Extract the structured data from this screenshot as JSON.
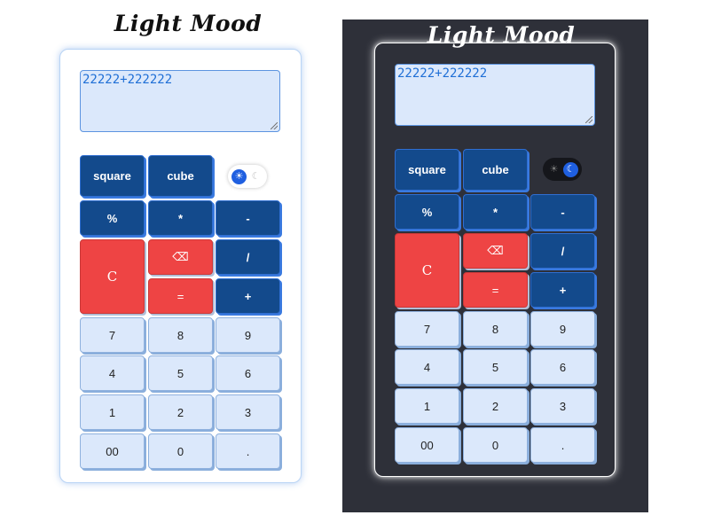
{
  "light": {
    "title": "Light Mood",
    "display_value": "22222+222222",
    "theme_mode": "light"
  },
  "dark": {
    "title": "Light Mood",
    "display_value": "22222+222222",
    "theme_mode": "dark"
  },
  "keys": {
    "square": "square",
    "cube": "cube",
    "percent": "%",
    "multiply": "*",
    "subtract": "-",
    "clear": "C",
    "backspace": "⌫",
    "divide": "/",
    "equals": "=",
    "add": "+",
    "seven": "7",
    "eight": "8",
    "nine": "9",
    "four": "4",
    "five": "5",
    "six": "6",
    "one": "1",
    "two": "2",
    "three": "3",
    "double_zero": "00",
    "zero": "0",
    "decimal": "."
  },
  "icons": {
    "sun": "☀",
    "moon": "☾"
  },
  "colors": {
    "operator_key": "#134a8c",
    "danger_key": "#ee4444",
    "number_key": "#dbe8fb",
    "dark_background": "#2e3039",
    "toggle_active": "#1f5fe0"
  }
}
